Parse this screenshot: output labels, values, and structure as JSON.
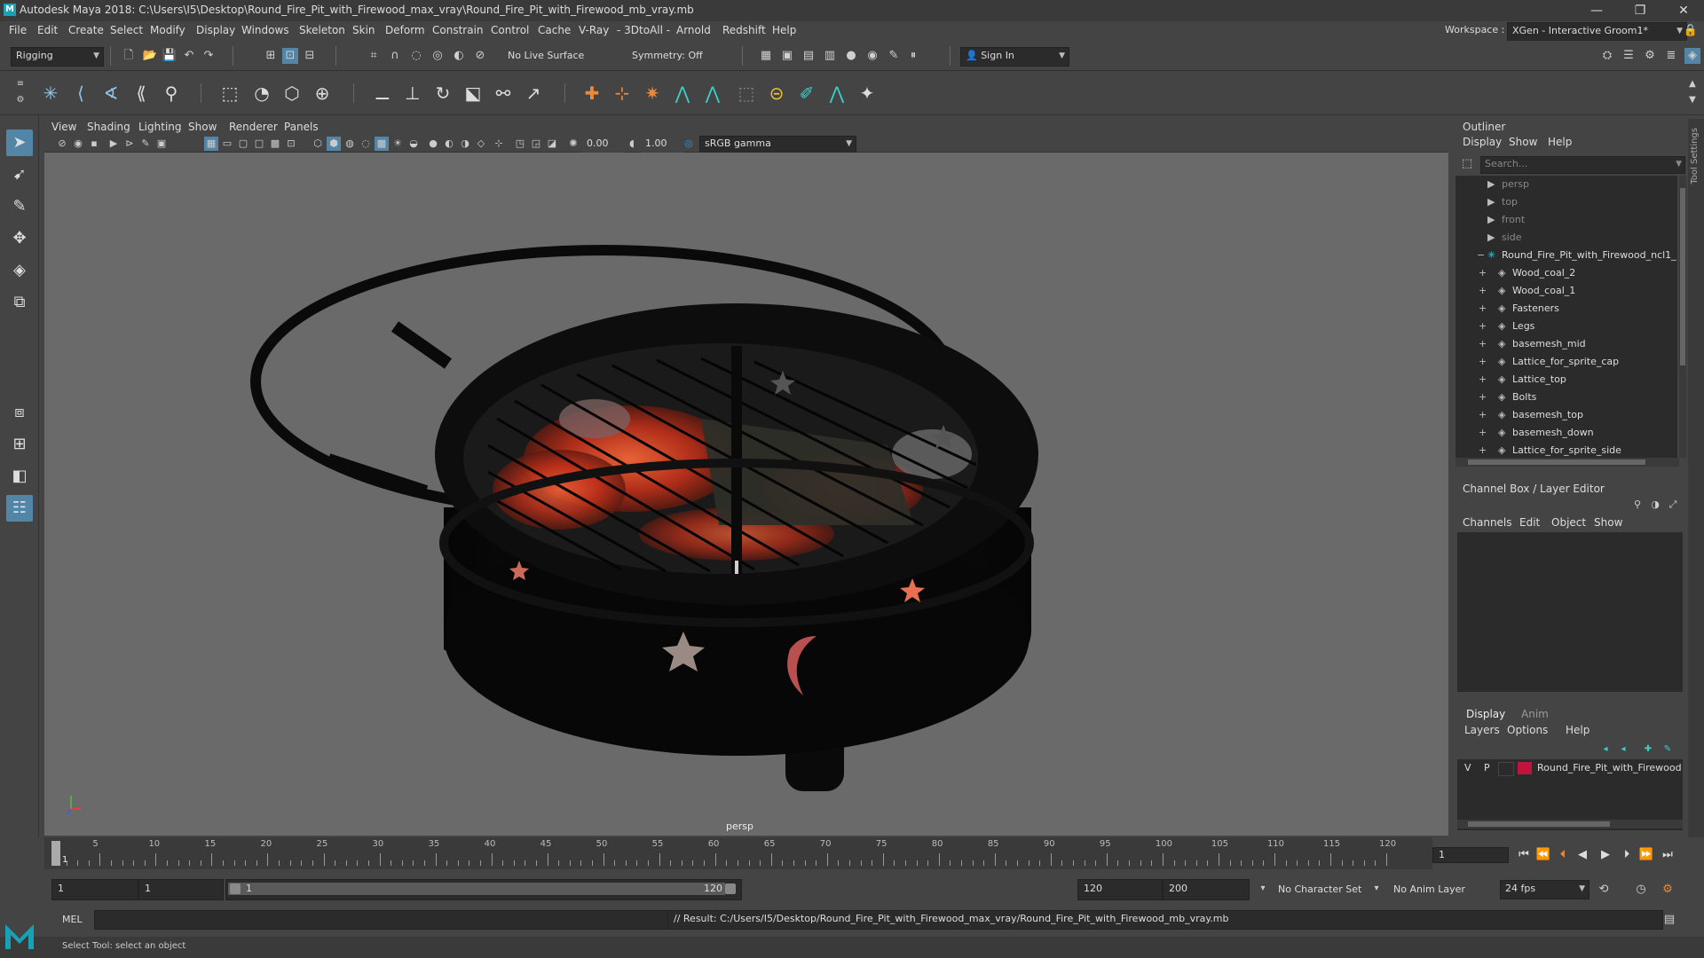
{
  "window": {
    "app_letter": "M",
    "title": "Autodesk Maya 2018: C:\\Users\\I5\\Desktop\\Round_Fire_Pit_with_Firewood_max_vray\\Round_Fire_Pit_with_Firewood_mb_vray.mb",
    "minimize": "—",
    "maximize": "❐",
    "close": "✕"
  },
  "menubar": {
    "items": [
      "File",
      "Edit",
      "Create",
      "Select",
      "Modify",
      "Display",
      "Windows",
      "Skeleton",
      "Skin",
      "Deform",
      "Constrain",
      "Control",
      "Cache",
      "V-Ray",
      "- 3DtoAll -",
      "Arnold",
      "Redshift",
      "Help"
    ],
    "workspace_label": "Workspace :",
    "workspace_value": "XGen - Interactive Groom1*"
  },
  "statusline": {
    "menuset": "Rigging",
    "live_surface": "No Live Surface",
    "symmetry": "Symmetry: Off",
    "sign_in": "Sign In"
  },
  "viewport": {
    "menu": [
      "View",
      "Shading",
      "Lighting",
      "Show",
      "Renderer",
      "Panels"
    ],
    "exposure": "0.00",
    "gamma": "1.00",
    "color_space": "sRGB gamma",
    "camera_label": "persp"
  },
  "outliner": {
    "title": "Outliner",
    "menu": [
      "Display",
      "Show",
      "Help"
    ],
    "search_placeholder": "Search...",
    "items": [
      {
        "label": "persp",
        "dim": true,
        "indent": 0,
        "icon": "camera-icon"
      },
      {
        "label": "top",
        "dim": true,
        "indent": 0,
        "icon": "camera-icon"
      },
      {
        "label": "front",
        "dim": true,
        "indent": 0,
        "icon": "camera-icon"
      },
      {
        "label": "side",
        "dim": true,
        "indent": 0,
        "icon": "camera-icon"
      },
      {
        "label": "Round_Fire_Pit_with_Firewood_ncl1_",
        "dim": false,
        "indent": 0,
        "icon": "group-icon",
        "expand": "−"
      },
      {
        "label": "Wood_coal_2",
        "dim": false,
        "indent": 1,
        "icon": "mesh-icon"
      },
      {
        "label": "Wood_coal_1",
        "dim": false,
        "indent": 1,
        "icon": "mesh-icon"
      },
      {
        "label": "Fasteners",
        "dim": false,
        "indent": 1,
        "icon": "mesh-icon"
      },
      {
        "label": "Legs",
        "dim": false,
        "indent": 1,
        "icon": "mesh-icon"
      },
      {
        "label": "basemesh_mid",
        "dim": false,
        "indent": 1,
        "icon": "mesh-icon"
      },
      {
        "label": "Lattice_for_sprite_cap",
        "dim": false,
        "indent": 1,
        "icon": "mesh-icon"
      },
      {
        "label": "Lattice_top",
        "dim": false,
        "indent": 1,
        "icon": "mesh-icon"
      },
      {
        "label": "Bolts",
        "dim": false,
        "indent": 1,
        "icon": "mesh-icon"
      },
      {
        "label": "basemesh_top",
        "dim": false,
        "indent": 1,
        "icon": "mesh-icon"
      },
      {
        "label": "basemesh_down",
        "dim": false,
        "indent": 1,
        "icon": "mesh-icon"
      },
      {
        "label": "Lattice_for_sprite_side",
        "dim": false,
        "indent": 1,
        "icon": "mesh-icon"
      }
    ]
  },
  "channelbox": {
    "title": "Channel Box / Layer Editor",
    "menu": [
      "Channels",
      "Edit",
      "Object",
      "Show"
    ]
  },
  "layereditor": {
    "tabs": [
      "Display",
      "Anim"
    ],
    "menu": [
      "Layers",
      "Options",
      "Help"
    ],
    "layer": {
      "v": "V",
      "p": "P",
      "name": "Round_Fire_Pit_with_Firewood",
      "color": "#c0143c"
    }
  },
  "timeslider": {
    "labels": [
      "5",
      "10",
      "15",
      "20",
      "25",
      "30",
      "35",
      "40",
      "45",
      "50",
      "55",
      "60",
      "65",
      "70",
      "75",
      "80",
      "85",
      "90",
      "95",
      "100",
      "105",
      "110",
      "115",
      "120"
    ],
    "current_marker": "1",
    "current_frame": "1"
  },
  "range": {
    "start": "1",
    "playback_start": "1",
    "slider_start": "1",
    "slider_end": "120",
    "playback_end": "120",
    "end": "200",
    "character_set": "No Character Set",
    "anim_layer": "No Anim Layer",
    "fps": "24 fps"
  },
  "cmdline": {
    "lang": "MEL",
    "result": "// Result: C:/Users/I5/Desktop/Round_Fire_Pit_with_Firewood_max_vray/Round_Fire_Pit_with_Firewood_mb_vray.mb"
  },
  "helpline": {
    "text": "Select Tool: select an object"
  },
  "side_tab": {
    "label": "Tool Settings"
  }
}
